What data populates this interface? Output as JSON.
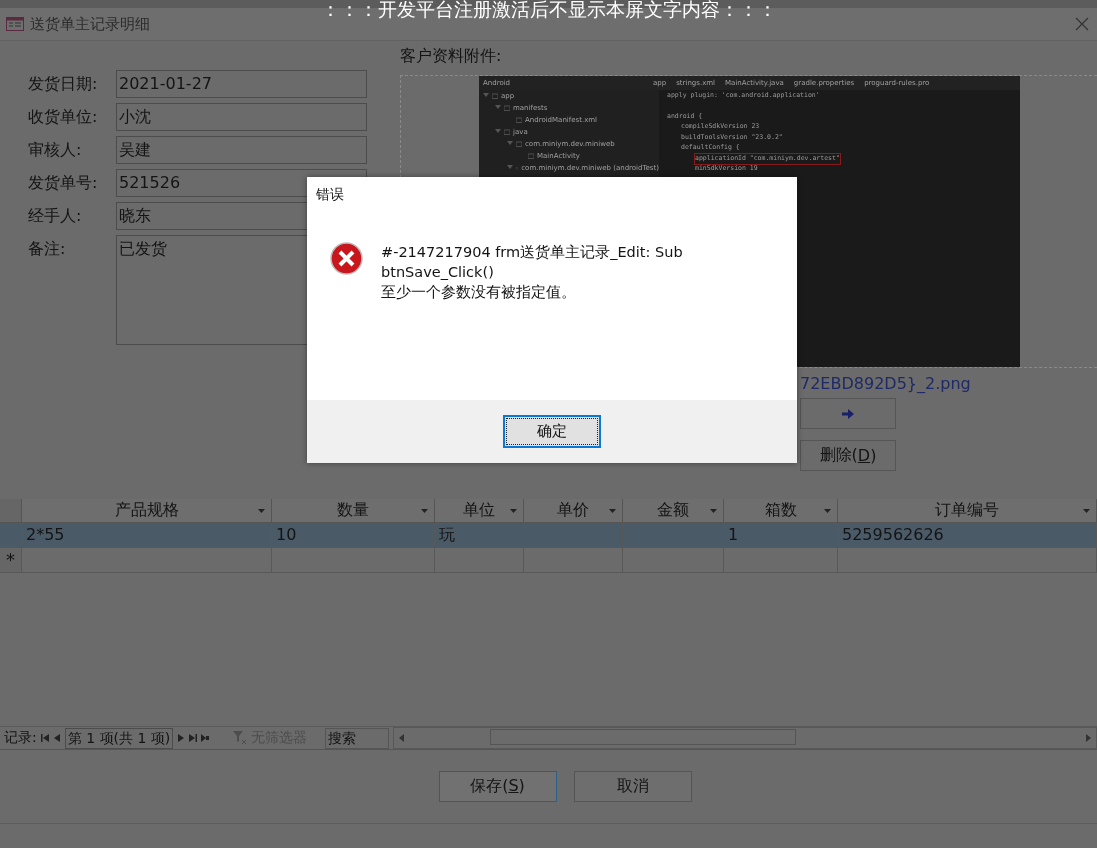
{
  "banner": "：：：开发平台注册激活后不显示本屏文字内容：：：",
  "window": {
    "title": "送货单主记录明细"
  },
  "form": {
    "fields": [
      {
        "label": "发货日期:",
        "value": "2021-01-27",
        "kind": "line"
      },
      {
        "label": "收货单位:",
        "value": "小沈",
        "kind": "line"
      },
      {
        "label": "审核人:",
        "value": "吴建",
        "kind": "line"
      },
      {
        "label": "发货单号:",
        "value": "521526",
        "kind": "line"
      },
      {
        "label": "经手人:",
        "value": "晓东",
        "kind": "line"
      },
      {
        "label": "备注:",
        "value": "已发货",
        "kind": "memo"
      }
    ]
  },
  "attachment": {
    "label": "客户资料附件:",
    "screenshot": {
      "project_label": "Android",
      "tabs": [
        "app",
        "strings.xml",
        "MainActivity.java",
        "gradle.properties",
        "proguard-rules.pro"
      ],
      "tree": [
        {
          "label": "app",
          "expanded": true,
          "children": [
            {
              "label": "manifests",
              "expanded": true,
              "children": [
                {
                  "label": "AndroidManifest.xml"
                }
              ]
            },
            {
              "label": "java",
              "expanded": true,
              "children": [
                {
                  "label": "com.miniym.dev.miniweb",
                  "expanded": true,
                  "children": [
                    {
                      "label": "MainActivity"
                    }
                  ]
                },
                {
                  "label": "com.miniym.dev.miniweb (androidTest)",
                  "expanded": true
                }
              ]
            }
          ]
        }
      ],
      "code": [
        {
          "line": "apply plugin: 'com.android.application'"
        },
        {
          "line": "android {",
          "children": [
            {
              "line": "compileSdkVersion 23"
            },
            {
              "line": "buildToolsVersion \"23.0.2\""
            },
            {
              "line": "defaultConfig {",
              "children": [
                {
                  "line": "applicationId \"com.miniym.dev.artest\"",
                  "highlighted": true
                },
                {
                  "line": "minSdkVersion 19"
                }
              ]
            }
          ]
        }
      ]
    },
    "filename": "72EBD892D5}_2.png",
    "buttons": [
      {
        "kind": "next"
      },
      {
        "kind": "text",
        "label": "删除(D)"
      }
    ]
  },
  "grid": {
    "columns": [
      "产品规格",
      "数量",
      "单位",
      "单价",
      "金额",
      "箱数",
      "订单编号"
    ],
    "rows": [
      {
        "cells": [
          "2*55",
          "10",
          "玩",
          null,
          null,
          "1",
          "5259562626"
        ],
        "selected": true
      }
    ],
    "new_row_marker": "*"
  },
  "navigator": {
    "label": "记录:",
    "position": "第 1 项(共 1 项)",
    "filter": {
      "label": "无筛选器",
      "disabled": true
    },
    "search_placeholder": "搜索"
  },
  "footer_buttons": [
    {
      "label": "保存(S)",
      "default": true
    },
    {
      "label": "取消",
      "default": false
    }
  ],
  "dialog": {
    "title": "错误",
    "messages": [
      "#-2147217904 frm送货单主记录_Edit: Sub btnSave_Click()",
      "至少一个参数没有被指定值。"
    ],
    "button": "确定"
  }
}
